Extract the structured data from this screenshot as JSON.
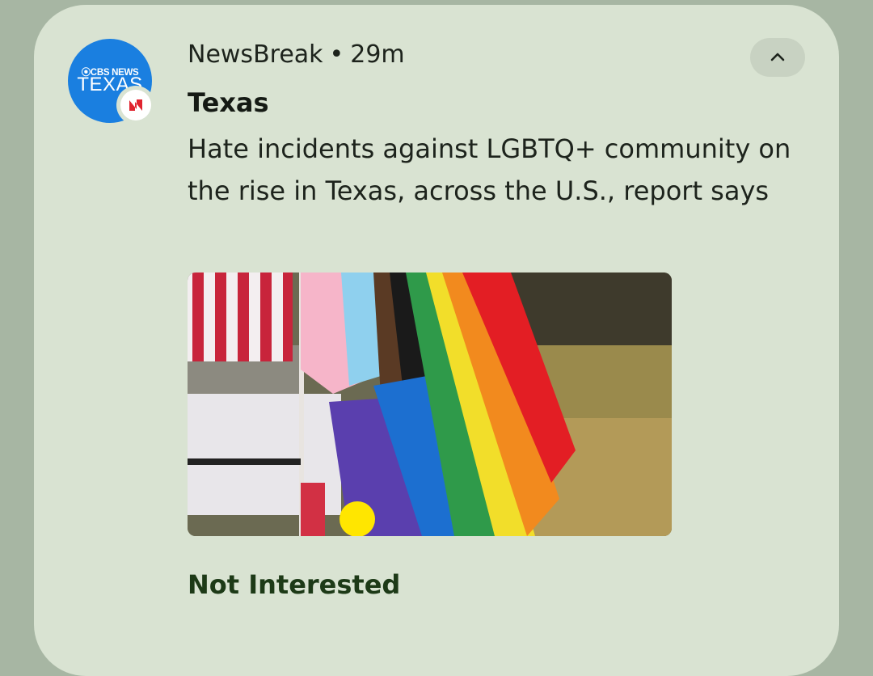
{
  "notification": {
    "app_icon": {
      "brand_top": "⦿CBS NEWS",
      "brand_main": "TEXAS",
      "badge_icon": "newsbreak-logo-icon"
    },
    "app_name": "NewsBreak",
    "separator": "•",
    "time": "29m",
    "collapse_icon": "chevron-up-icon",
    "title": "Texas",
    "text": "Hate incidents against LGBTQ+ community on the rise in Texas, across the U.S., report says",
    "image_icon": "pride-flag-photo",
    "action_label": "Not Interested"
  },
  "colors": {
    "background": "#a7b6a3",
    "card": "#d9e3d2",
    "brand_blue": "#1a7fe0",
    "badge_red": "#e0242f",
    "action_text": "#1d3a17"
  }
}
